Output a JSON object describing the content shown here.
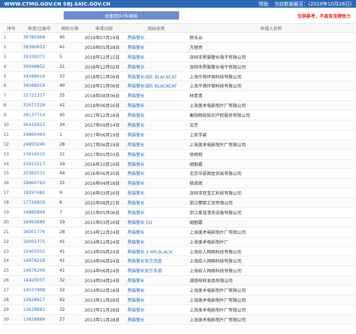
{
  "header": {
    "site": "WWW.CTMO.GOV.CN SBJ.SAIC.GOV.CN",
    "help": "帮助",
    "data_date": "当前数据截至：(2019年10月28日)"
  },
  "search": {
    "result_label": "检索到97件商标",
    "notice": "仅供参考，不具有法律效力"
  },
  "table": {
    "columns": [
      "序号",
      "申请/注册号",
      "国际分类",
      "申请日期",
      "商标名称",
      "申请人名称"
    ],
    "rows": [
      {
        "no": "1",
        "reg": "39785968",
        "cls": "45",
        "date": "2019年07月19日",
        "tm": "黑猫警长",
        "applicant": "颜玉云"
      },
      {
        "no": "2",
        "reg": "38380632",
        "cls": "41",
        "date": "2019年05月28日",
        "tm": "黑猫警长",
        "applicant": "方旭亮"
      },
      {
        "no": "3",
        "reg": "35339371",
        "cls": "5",
        "date": "2018年12月15日",
        "tm": "黑猫警长",
        "applicant": "深圳市黑猫警长电子有限公司"
      },
      {
        "no": "4",
        "reg": "35048852",
        "cls": "21",
        "date": "2018年12月02日",
        "tm": "黑猫警长",
        "applicant": "深圳市黑猫警长电子有限公司"
      },
      {
        "no": "5",
        "reg": "34588019",
        "cls": "37",
        "date": "2018年11月09日",
        "tm": "黑猫警长战队 BLACKCAT",
        "applicant": "上海宁燕环保科技有限公司"
      },
      {
        "no": "6",
        "reg": "34588019",
        "cls": "40",
        "date": "2018年11月09日",
        "tm": "黑猫警长战队 BLACKCAT",
        "applicant": "上海宁燕环保科技有限公司"
      },
      {
        "no": "7",
        "reg": "32721337",
        "cls": "25",
        "date": "2018年08月06日",
        "tm": "黑猫警长",
        "applicant": "林青青"
      },
      {
        "no": "8",
        "reg": "31671229",
        "cls": "41",
        "date": "2018年06月16日",
        "tm": "黑猫警长",
        "applicant": "上海美术电影制片厂有限公司"
      },
      {
        "no": "9",
        "reg": "28137714",
        "cls": "45",
        "date": "2017年12月18日",
        "tm": "黑猫警长",
        "applicant": "衡阳畅晓知识产权服务有限公司"
      },
      {
        "no": "10",
        "reg": "26410023",
        "cls": "34",
        "date": "2017年09月14日",
        "tm": "黑猫警长",
        "applicant": "王芳"
      },
      {
        "no": "11",
        "reg": "24860464",
        "cls": "1",
        "date": "2017年06月19日",
        "tm": "黑猫警长",
        "applicant": "上官学颖"
      },
      {
        "no": "12",
        "reg": "24850246",
        "cls": "28",
        "date": "2017年06月19日",
        "tm": "黑猫警长",
        "applicant": "上海美术电影制片厂有限公司"
      },
      {
        "no": "13",
        "reg": "23916210",
        "cls": "21",
        "date": "2017年05月03日",
        "tm": "黑猫警长",
        "applicant": "徐明明"
      },
      {
        "no": "14",
        "reg": "21611217",
        "cls": "19",
        "date": "2016年10月19日",
        "tm": "黑猫警长",
        "applicant": "胡丽霞"
      },
      {
        "no": "15",
        "reg": "20362532",
        "cls": "44",
        "date": "2016年06月20日",
        "tm": "黑猫警长",
        "applicant": "北京华夏国金贸易有限公司"
      },
      {
        "no": "16",
        "reg": "19660763",
        "cls": "31",
        "date": "2016年04月18日",
        "tm": "黑猫警长",
        "applicant": "杨淑辉"
      },
      {
        "no": "17",
        "reg": "19297482",
        "cls": "9",
        "date": "2016年03月16日",
        "tm": "黑猫警长",
        "applicant": "深圳市双宝汇科技有限公司"
      },
      {
        "no": "18",
        "reg": "17726859",
        "cls": "6",
        "date": "2015年08月21日",
        "tm": "黑猫警长",
        "applicant": "浙江攀臣工贸有限公司"
      },
      {
        "no": "19",
        "reg": "16885896",
        "cls": "7",
        "date": "2015年05月06日",
        "tm": "黑猫警长",
        "applicant": "浙江爱普清洗设备有限公司"
      },
      {
        "no": "20",
        "reg": "16493889",
        "cls": "19",
        "date": "2015年03月16日",
        "tm": "黑猫警长 EO",
        "applicant": "胡丽霞"
      },
      {
        "no": "21",
        "reg": "16001776",
        "cls": "28",
        "date": "2014年12月24日",
        "tm": "黑猫警长",
        "applicant": "上海美术电影制片厂有限公司"
      },
      {
        "no": "22",
        "reg": "16001775",
        "cls": "41",
        "date": "2014年12月24日",
        "tm": "黑猫警长",
        "applicant": "上海美术电影制片厂"
      },
      {
        "no": "23",
        "reg": "15405055",
        "cls": "41",
        "date": "2014年09月24日",
        "tm": "黑猫警长 2 MR.BLACK",
        "applicant": "上海巨人网络科技有限公司"
      },
      {
        "no": "24",
        "reg": "14976218",
        "cls": "41",
        "date": "2014年06月24日",
        "tm": "黑猫警长官方页游",
        "applicant": "上海巨人网络科技有限公司"
      },
      {
        "no": "25",
        "reg": "14976206",
        "cls": "41",
        "date": "2014年06月24日",
        "tm": "黑猫警长官方手游",
        "applicant": "上海巨人网络科技有限公司"
      },
      {
        "no": "26",
        "reg": "14420037",
        "cls": "32",
        "date": "2014年04月24日",
        "tm": "黑猫警长",
        "applicant": "湖南旺旺食品有限公司"
      },
      {
        "no": "27",
        "reg": "14037908",
        "cls": "32",
        "date": "2014年02月18日",
        "tm": "黑猫警长",
        "applicant": "上海美术电影制片厂有限公司"
      },
      {
        "no": "28",
        "reg": "13628917",
        "cls": "42",
        "date": "2013年11月28日",
        "tm": "黑猫警长",
        "applicant": "上海美术电影制片厂有限公司"
      },
      {
        "no": "29",
        "reg": "13628883",
        "cls": "32",
        "date": "2013年11月28日",
        "tm": "黑猫警长",
        "applicant": "上海美术电影制片厂有限公司"
      },
      {
        "no": "30",
        "reg": "13628869",
        "cls": "27",
        "date": "2013年11月28日",
        "tm": "黑猫警长",
        "applicant": "上海美术电影制片厂有限公司"
      }
    ]
  }
}
